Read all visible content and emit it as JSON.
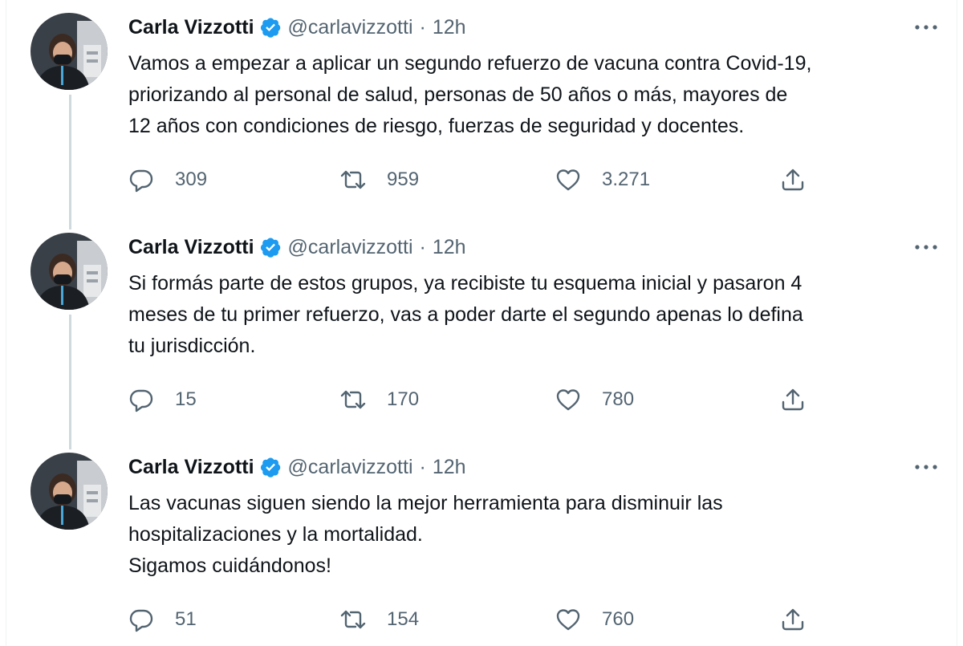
{
  "author": {
    "name": "Carla Vizzotti",
    "handle": "@carlavizzotti",
    "avatar_icon": "profile-avatar",
    "verified_icon": "verified-badge-icon",
    "verified_color": "#1d9bf0"
  },
  "tweets": [
    {
      "time": "12h",
      "text": "Vamos a empezar a aplicar un segundo refuerzo de vacuna contra Covid-19,\npriorizando al personal de salud, personas de 50 años o más, mayores de\n12 años con condiciones de riesgo, fuerzas de seguridad y docentes.",
      "replies": "309",
      "retweets": "959",
      "likes": "3.271"
    },
    {
      "time": "12h",
      "text": "Si formás parte de estos grupos, ya recibiste tu esquema inicial y pasaron 4\nmeses de tu primer refuerzo, vas a poder darte el segundo apenas lo defina\ntu jurisdicción.",
      "replies": "15",
      "retweets": "170",
      "likes": "780"
    },
    {
      "time": "12h",
      "text": "Las vacunas siguen siendo la mejor herramienta para disminuir las\nhospitalizaciones y la mortalidad.\nSigamos cuidándonos!",
      "replies": "51",
      "retweets": "154",
      "likes": "760"
    }
  ],
  "separator": "·",
  "colors": {
    "text": "#0f1419",
    "secondary": "#536471",
    "thread_line": "#cfd9de",
    "accent": "#1d9bf0"
  }
}
